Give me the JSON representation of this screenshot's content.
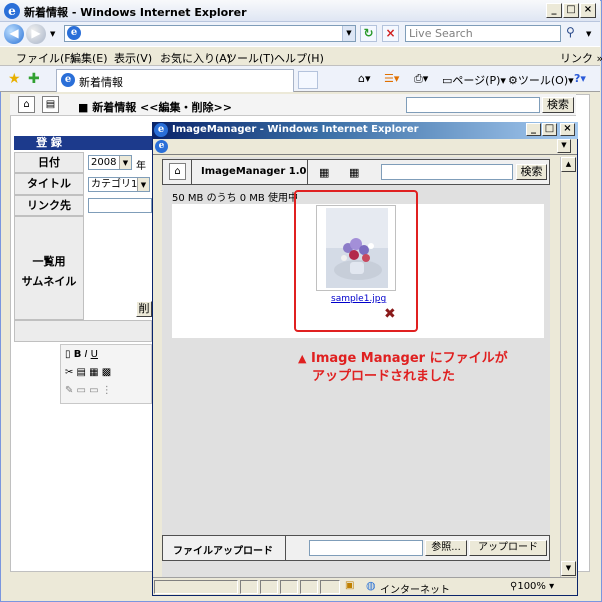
{
  "outer_window": {
    "title": "新着情報 - Windows Internet Explorer",
    "search_placeholder": "Live Search",
    "menu": [
      "ファイル(F)",
      "編集(E)",
      "表示(V)",
      "お気に入り(A)",
      "ツール(T)",
      "ヘルプ(H)"
    ],
    "links_label": "リンク »",
    "tab_label": "新着情報",
    "toolbar": {
      "page_label": "ページ(P)",
      "tools_label": "ツール(O)"
    }
  },
  "bg_page": {
    "header_title": "■ 新着情報 <<編集・削除>>",
    "search_button": "検索",
    "register_label": "登 録",
    "form_labels": {
      "date": "日付",
      "title": "タイトル",
      "link": "リンク先",
      "thumb_1": "一覧用",
      "thumb_2": "サムネイル"
    },
    "year_value": "2008",
    "year_suffix": "年",
    "category_value": "カテゴリ1",
    "delete_button_partial": "削"
  },
  "popup": {
    "title": "ImageManager - Windows Internet Explorer",
    "im_title": "ImageManager 1.0",
    "search_button": "検索",
    "usage_text": "50 MB のうち 0 MB 使用中",
    "file_name": "sample1.jpg",
    "upload_label": "ファイルアップロード",
    "browse_button": "参照...",
    "upload_button": "アップロード",
    "status_zone": "インターネット",
    "status_zoom": "100%"
  },
  "annotation": {
    "marker": "▲",
    "line1": "Image Manager にファイルが",
    "line2": "アップロードされました",
    "color": "#e02020"
  }
}
